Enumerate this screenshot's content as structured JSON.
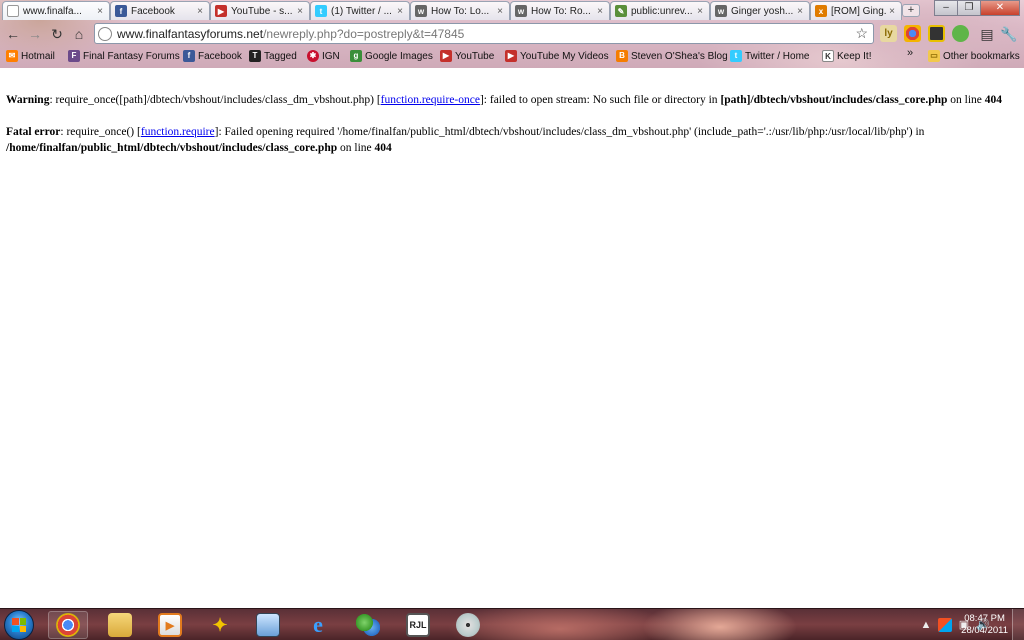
{
  "browser": {
    "tabs": [
      {
        "label": "www.finalfa...",
        "favicon": "page-icon",
        "active": true
      },
      {
        "label": "Facebook",
        "favicon": "facebook-icon"
      },
      {
        "label": "YouTube - s...",
        "favicon": "youtube-icon"
      },
      {
        "label": "(1) Twitter / ...",
        "favicon": "twitter-icon"
      },
      {
        "label": "How To: Lo...",
        "favicon": "wonderhowto-icon"
      },
      {
        "label": "How To: Ro...",
        "favicon": "wonderhowto-icon"
      },
      {
        "label": "public:unrev...",
        "favicon": "wiki-icon"
      },
      {
        "label": "Ginger yosh...",
        "favicon": "wonderhowto-icon"
      },
      {
        "label": "[ROM] Ging...",
        "favicon": "xda-icon"
      }
    ],
    "tab_close_glyph": "×",
    "new_tab_glyph": "+",
    "window_controls": {
      "minimize": "–",
      "maximize": "❐",
      "close": "✕"
    },
    "address": {
      "host": "www.finalfantasyforums.net",
      "path": "/newreply.php?do=postreply&t=47845"
    },
    "extensions": [
      "ly",
      "chrome-icon",
      "extension-icon",
      "evernote-icon"
    ],
    "bookmarks": [
      {
        "label": "Hotmail",
        "icon": "hotmail-icon"
      },
      {
        "label": "Final Fantasy Forums",
        "icon": "ff-icon"
      },
      {
        "label": "Facebook",
        "icon": "facebook-icon"
      },
      {
        "label": "Tagged",
        "icon": "tagged-icon"
      },
      {
        "label": "IGN",
        "icon": "ign-icon"
      },
      {
        "label": "Google Images",
        "icon": "google-icon"
      },
      {
        "label": "YouTube",
        "icon": "youtube-icon"
      },
      {
        "label": "YouTube My Videos",
        "icon": "youtube-icon"
      },
      {
        "label": "Steven O'Shea's Blog",
        "icon": "blogger-icon"
      },
      {
        "label": "Twitter / Home",
        "icon": "twitter-icon"
      },
      {
        "label": "Keep It!",
        "icon": "keepit-icon"
      }
    ],
    "bookmarks_overflow": "»",
    "other_bookmarks": "Other bookmarks"
  },
  "page": {
    "warning": {
      "label": "Warning",
      "text1": ": require_once([path]/dbtech/vbshout/includes/class_dm_vbshout.php) [",
      "link": "function.require-once",
      "text2": "]: failed to open stream: No such file or directory in ",
      "file": "[path]/dbtech/vbshout/includes/class_core.php",
      "text3": " on line ",
      "line": "404"
    },
    "fatal": {
      "label": "Fatal error",
      "text1": ": require_once() [",
      "link": "function.require",
      "text2": "]: Failed opening required '/home/finalfan/public_html/dbtech/vbshout/includes/class_dm_vbshout.php' (include_path='.:/usr/lib/php:/usr/local/lib/php') in ",
      "file": "/home/finalfan/public_html/dbtech/vbshout/includes/class_core.php",
      "text3": " on line ",
      "line": "404"
    }
  },
  "taskbar": {
    "apps": [
      {
        "name": "chrome",
        "icon": "chrome-icon"
      },
      {
        "name": "explorer",
        "icon": "folder-icon"
      },
      {
        "name": "media",
        "icon": "media-player-icon"
      },
      {
        "name": "bird",
        "icon": "bird-icon"
      },
      {
        "name": "laptop",
        "icon": "laptop-icon"
      },
      {
        "name": "ie",
        "icon": "internet-explorer-icon"
      },
      {
        "name": "messenger",
        "icon": "messenger-icon"
      },
      {
        "name": "rjl",
        "icon": "rjl-icon",
        "text": "RJL"
      },
      {
        "name": "disc",
        "icon": "disc-icon"
      }
    ],
    "tray_show_hidden": "▲",
    "clock": {
      "time": "08:47 PM",
      "date": "28/04/2011"
    }
  },
  "colors": {
    "link": "#0000ee",
    "taskbar": "#6a363b",
    "chrome_bg": "#dcbac7"
  }
}
